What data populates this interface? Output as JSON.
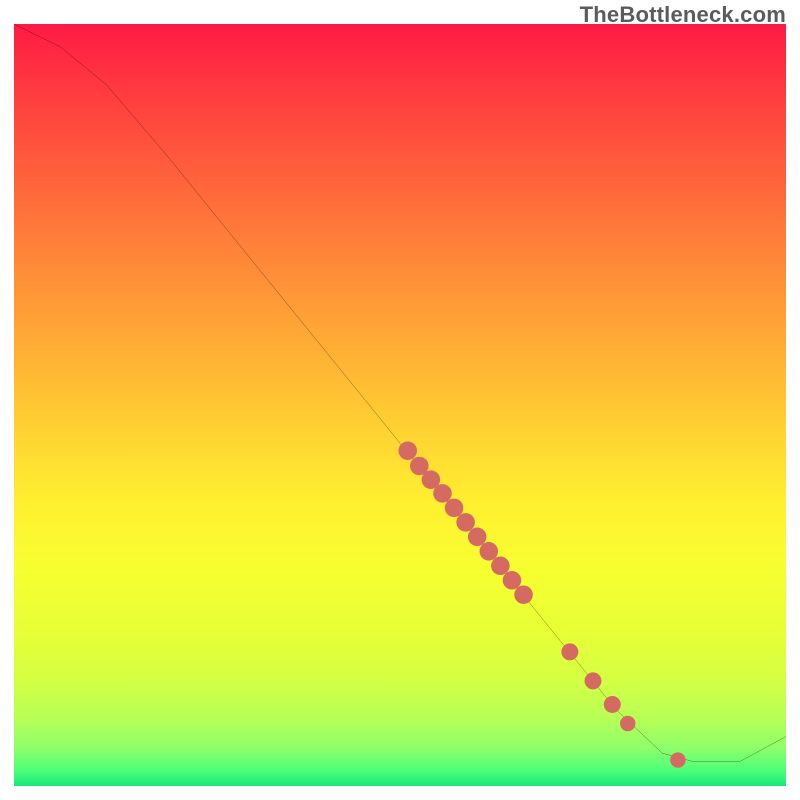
{
  "watermark": "TheBottleneck.com",
  "colors": {
    "dot_fill": "#d46a62",
    "curve_stroke": "#000000"
  },
  "chart_data": {
    "type": "line",
    "title": "",
    "xlabel": "",
    "ylabel": "",
    "xlim": [
      0,
      100
    ],
    "ylim": [
      0,
      100
    ],
    "curve_points": [
      {
        "x": 0,
        "y": 100
      },
      {
        "x": 6,
        "y": 97
      },
      {
        "x": 12,
        "y": 92
      },
      {
        "x": 20,
        "y": 82.5
      },
      {
        "x": 30,
        "y": 70
      },
      {
        "x": 40,
        "y": 57.5
      },
      {
        "x": 50,
        "y": 45
      },
      {
        "x": 60,
        "y": 32.5
      },
      {
        "x": 70,
        "y": 20
      },
      {
        "x": 78,
        "y": 10
      },
      {
        "x": 84,
        "y": 4.3
      },
      {
        "x": 88,
        "y": 3.2
      },
      {
        "x": 94,
        "y": 3.2
      },
      {
        "x": 100,
        "y": 6.5
      }
    ],
    "dots": [
      {
        "x": 51.0,
        "y": 44.0,
        "r": 1.2
      },
      {
        "x": 52.5,
        "y": 42.0,
        "r": 1.2
      },
      {
        "x": 54.0,
        "y": 40.2,
        "r": 1.2
      },
      {
        "x": 55.5,
        "y": 38.4,
        "r": 1.2
      },
      {
        "x": 57.0,
        "y": 36.5,
        "r": 1.2
      },
      {
        "x": 58.5,
        "y": 34.6,
        "r": 1.2
      },
      {
        "x": 60.0,
        "y": 32.7,
        "r": 1.2
      },
      {
        "x": 61.5,
        "y": 30.8,
        "r": 1.2
      },
      {
        "x": 63.0,
        "y": 28.9,
        "r": 1.2
      },
      {
        "x": 64.5,
        "y": 27.0,
        "r": 1.2
      },
      {
        "x": 66.0,
        "y": 25.1,
        "r": 1.2
      },
      {
        "x": 72.0,
        "y": 17.6,
        "r": 1.1
      },
      {
        "x": 75.0,
        "y": 13.8,
        "r": 1.1
      },
      {
        "x": 77.5,
        "y": 10.7,
        "r": 1.1
      },
      {
        "x": 79.5,
        "y": 8.2,
        "r": 1.0
      },
      {
        "x": 86.0,
        "y": 3.4,
        "r": 1.0
      }
    ]
  }
}
